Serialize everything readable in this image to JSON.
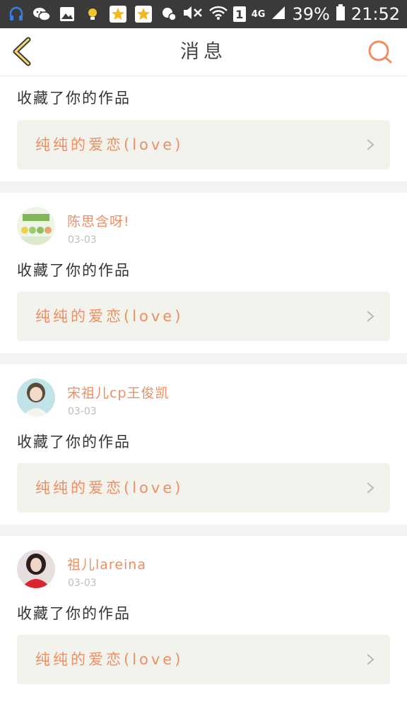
{
  "status_bar": {
    "battery": "39%",
    "time": "21:52",
    "network": "4G",
    "sim": "1",
    "icons": [
      "headset-icon",
      "wechat-icon",
      "gallery-icon",
      "bulb-icon",
      "star-app-icon",
      "star-app-icon",
      "location-icon",
      "mute-icon",
      "wifi-icon",
      "sim-icon",
      "signal-icon",
      "battery-icon"
    ]
  },
  "header": {
    "title": "消息",
    "back_icon": "chevron-left-icon",
    "search_icon": "search-icon",
    "accent": "#ec8f64"
  },
  "messages": [
    {
      "action": "收藏了你的作品",
      "work_title": "纯纯的爱恋(love)"
    },
    {
      "user": "陈思含呀!",
      "date": "03-03",
      "action": "收藏了你的作品",
      "work_title": "纯纯的爱恋(love)"
    },
    {
      "user": "宋祖儿cp王俊凯",
      "date": "03-03",
      "action": "收藏了你的作品",
      "work_title": "纯纯的爱恋(love)"
    },
    {
      "user": "祖儿lareina",
      "date": "03-03",
      "action": "收藏了你的作品",
      "work_title": "纯纯的爱恋(love)"
    }
  ],
  "colors": {
    "status_bar_bg": "#3a3a3a",
    "card_bg": "#f3f3ed",
    "separator": "#f3f3f3",
    "name": "#ec8f64",
    "date": "#bdbdbd"
  }
}
